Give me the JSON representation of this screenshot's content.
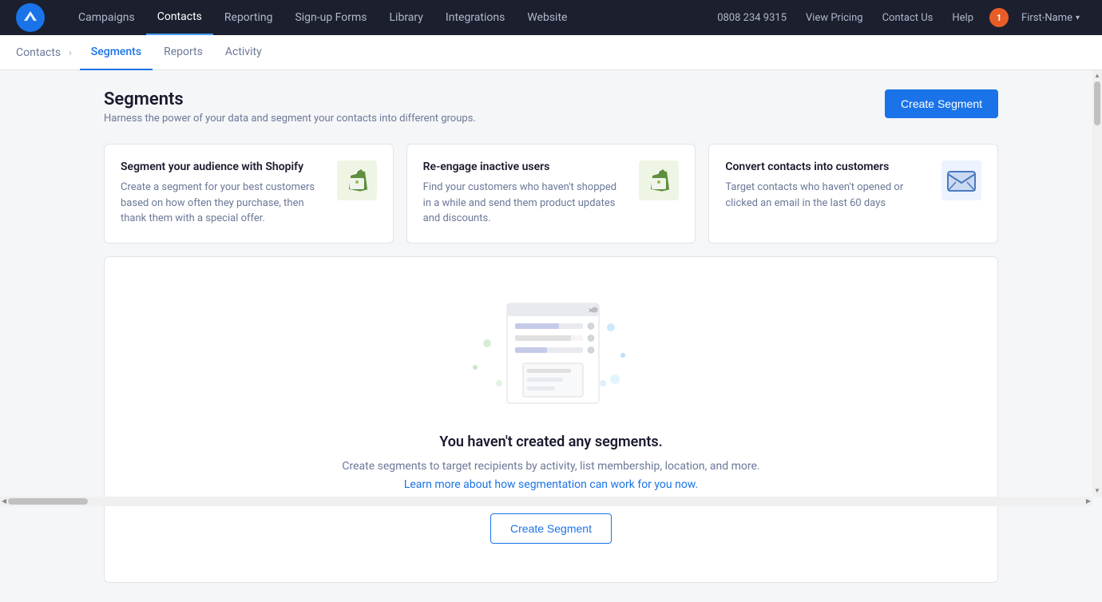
{
  "topNav": {
    "links": [
      {
        "id": "campaigns",
        "label": "Campaigns",
        "active": false
      },
      {
        "id": "contacts",
        "label": "Contacts",
        "active": true
      },
      {
        "id": "reporting",
        "label": "Reporting",
        "active": false
      },
      {
        "id": "sign-up-forms",
        "label": "Sign-up Forms",
        "active": false
      },
      {
        "id": "library",
        "label": "Library",
        "active": false
      },
      {
        "id": "integrations",
        "label": "Integrations",
        "active": false
      },
      {
        "id": "website",
        "label": "Website",
        "active": false
      }
    ],
    "rightLinks": [
      {
        "id": "phone",
        "label": "0808 234 9315"
      },
      {
        "id": "view-pricing",
        "label": "View Pricing"
      },
      {
        "id": "contact-us",
        "label": "Contact Us"
      },
      {
        "id": "help",
        "label": "Help"
      }
    ],
    "notification": "1",
    "userName": "First-Name"
  },
  "subNav": {
    "breadcrumb": [
      {
        "id": "contacts",
        "label": "Contacts"
      }
    ],
    "tabs": [
      {
        "id": "segments",
        "label": "Segments",
        "active": true
      },
      {
        "id": "reports",
        "label": "Reports",
        "active": false
      },
      {
        "id": "activity",
        "label": "Activity",
        "active": false
      }
    ]
  },
  "page": {
    "title": "Segments",
    "subtitle": "Harness the power of your data and segment your contacts into different groups.",
    "createButtonLabel": "Create Segment"
  },
  "cards": [
    {
      "id": "shopify-card",
      "title": "Segment your audience with Shopify",
      "description": "Create a segment for your best customers based on how often they purchase, then thank them with a special offer.",
      "iconType": "shopify"
    },
    {
      "id": "inactive-users-card",
      "title": "Re-engage inactive users",
      "description": "Find your customers who haven't shopped in a while and send them product updates and discounts.",
      "iconType": "shopify"
    },
    {
      "id": "convert-contacts-card",
      "title": "Convert contacts into customers",
      "description": "Target contacts who haven't opened or clicked an email in the last 60 days",
      "iconType": "email"
    }
  ],
  "emptyState": {
    "title": "You haven't created any segments.",
    "subtitle": "Create segments to target recipients by activity, list membership, location, and more.",
    "linkText": "Learn more about how segmentation can work for you now.",
    "createButtonLabel": "Create Segment"
  }
}
